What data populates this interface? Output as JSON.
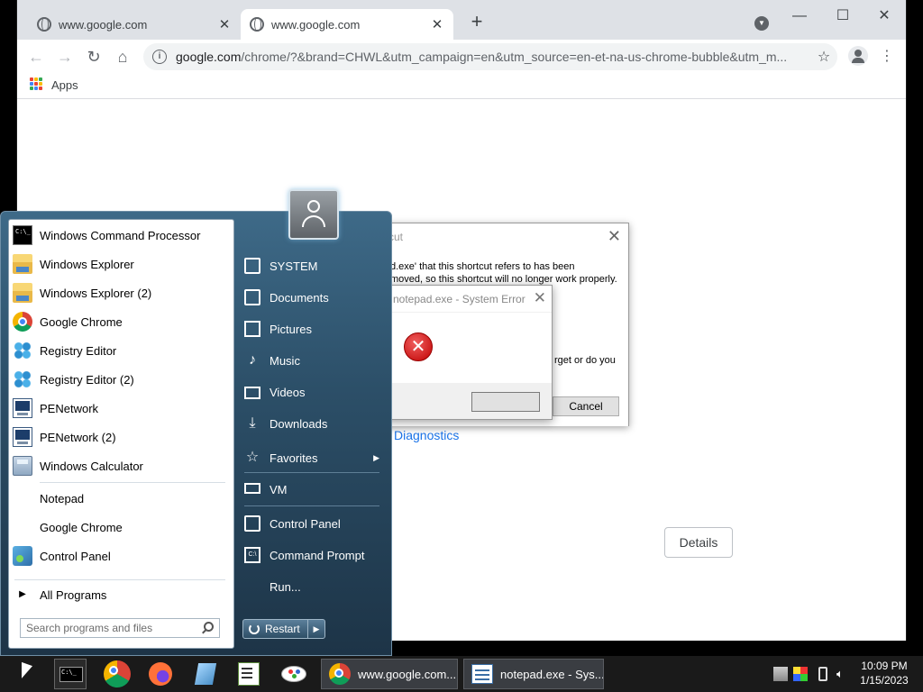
{
  "browser": {
    "tabs": [
      {
        "label": "www.google.com",
        "active": false
      },
      {
        "label": "www.google.com",
        "active": true
      }
    ],
    "new_tab": "+",
    "url_host": "google.com",
    "url_path": "/chrome/?&brand=CHWL&utm_campaign=en&utm_source=en-et-na-us-chrome-bubble&utm_m...",
    "bookmarks": [
      {
        "label": "Apps"
      }
    ],
    "page": {
      "diagnostics_link": "Diagnostics",
      "details_button": "Details"
    }
  },
  "shortcut_dialog": {
    "title": "cut",
    "message_lines": [
      "d.exe' that this shortcut refers to has been",
      "moved, so this shortcut will no longer work properly.",
      "rget or do you"
    ],
    "cancel_button": "Cancel"
  },
  "system_error": {
    "title": "notepad.exe - System Error",
    "ok_button": ""
  },
  "start_menu": {
    "pinned": [
      {
        "label": "Windows Command Processor",
        "icon": "cmd-icon"
      },
      {
        "label": "Windows Explorer",
        "icon": "folder-icon"
      },
      {
        "label": "Windows Explorer (2)",
        "icon": "folder-icon"
      },
      {
        "label": "Google Chrome",
        "icon": "chrome-icon"
      },
      {
        "label": "Registry Editor",
        "icon": "registry-icon"
      },
      {
        "label": "Registry Editor (2)",
        "icon": "registry-icon"
      },
      {
        "label": "PENetwork",
        "icon": "network-icon"
      },
      {
        "label": "PENetwork (2)",
        "icon": "network-icon"
      },
      {
        "label": "Windows Calculator",
        "icon": "calculator-icon"
      }
    ],
    "recent": [
      {
        "label": "Notepad",
        "icon": "notepad-icon"
      },
      {
        "label": "Google Chrome",
        "icon": "chrome-icon"
      },
      {
        "label": "Control Panel",
        "icon": "control-panel-icon"
      }
    ],
    "all_programs": "All Programs",
    "search_placeholder": "Search programs and files",
    "right": [
      {
        "label": "SYSTEM"
      },
      {
        "label": "Documents"
      },
      {
        "label": "Pictures"
      },
      {
        "label": "Music"
      },
      {
        "label": "Videos"
      },
      {
        "label": "Downloads"
      },
      {
        "label": "Favorites"
      },
      {
        "label": "VM"
      },
      {
        "label": "Control Panel"
      },
      {
        "label": "Command Prompt"
      },
      {
        "label": "Run..."
      }
    ],
    "restart_button": "Restart"
  },
  "taskbar": {
    "tasks": [
      {
        "label": "www.google.com..."
      },
      {
        "label": "notepad.exe - Sys..."
      }
    ],
    "time": "10:09 PM",
    "date": "1/15/2023"
  },
  "colors": {
    "chrome_tabstrip": "#dee1e6",
    "link": "#1a73e8",
    "start_menu": "#2c4f68",
    "taskbar": "#1a1a1a"
  }
}
